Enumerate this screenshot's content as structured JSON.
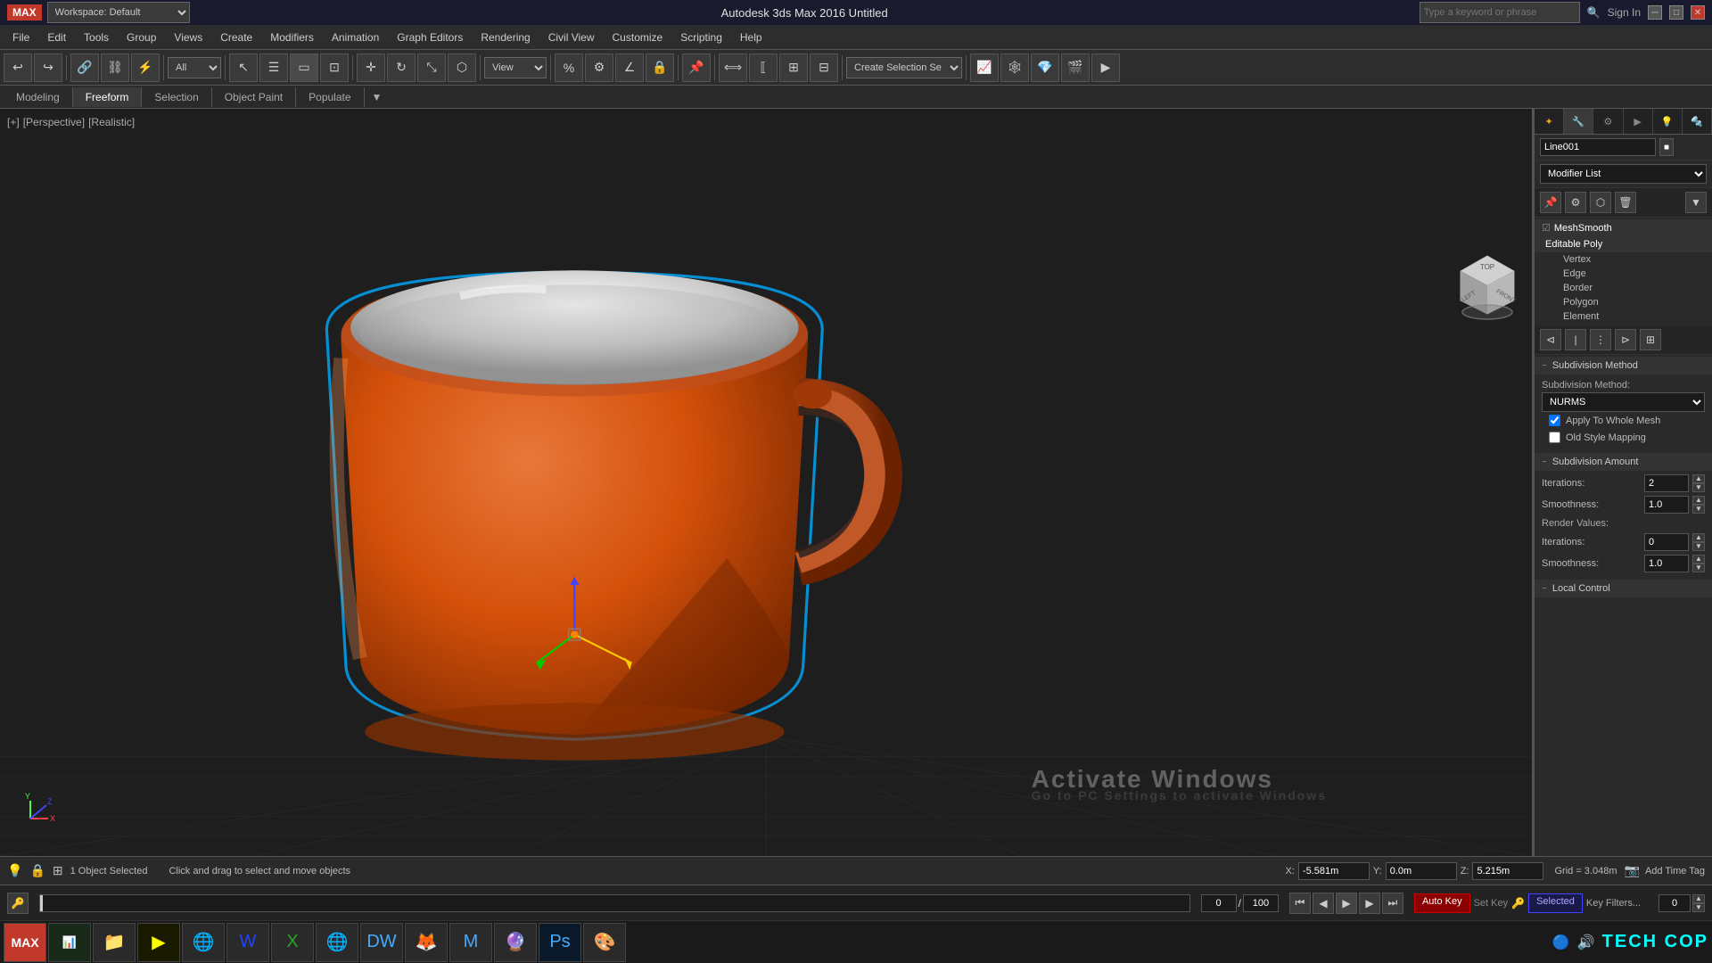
{
  "titlebar": {
    "app_logo": "MAX",
    "workspace": "Workspace: Default",
    "title": "Autodesk 3ds Max 2016   Untitled",
    "search_placeholder": "Type a keyword or phrase",
    "sign_in": "Sign In",
    "min_label": "─",
    "max_label": "□",
    "close_label": "✕"
  },
  "menubar": {
    "items": [
      "File",
      "Edit",
      "Tools",
      "Group",
      "Views",
      "Create",
      "Modifiers",
      "Animation",
      "Graph Editors",
      "Rendering",
      "Civil View",
      "Customize",
      "Scripting",
      "Help"
    ]
  },
  "toolbar2": {
    "tabs": [
      "Modeling",
      "Freeform",
      "Selection",
      "Object Paint",
      "Populate"
    ]
  },
  "viewport": {
    "labels": [
      "[+]",
      "[Perspective]",
      "[Realistic]"
    ],
    "cursor": "default"
  },
  "right_panel": {
    "object_name": "Line001",
    "modifier_list_label": "Modifier List",
    "stack": {
      "items": [
        {
          "label": "MeshSmooth",
          "type": "modifier",
          "selected": false
        },
        {
          "label": "Editable Poly",
          "type": "root",
          "selected": false
        },
        {
          "label": "Vertex",
          "type": "sub",
          "selected": false
        },
        {
          "label": "Edge",
          "type": "sub",
          "selected": false
        },
        {
          "label": "Border",
          "type": "sub",
          "selected": false
        },
        {
          "label": "Polygon",
          "type": "sub",
          "selected": false
        },
        {
          "label": "Element",
          "type": "sub",
          "selected": false
        }
      ]
    },
    "subdivision_method": {
      "section_label": "Subdivision Method",
      "method_label": "Subdivision Method:",
      "method_value": "NURMS",
      "apply_whole_mesh_label": "Apply To Whole Mesh",
      "apply_whole_mesh_checked": true,
      "old_style_label": "Old Style Mapping",
      "old_style_checked": false
    },
    "subdivision_amount": {
      "section_label": "Subdivision Amount",
      "iterations_label": "Iterations:",
      "iterations_value": "2",
      "smoothness_label": "Smoothness:",
      "smoothness_value": "1.0",
      "render_values_label": "Render Values:",
      "render_iter_label": "Iterations:",
      "render_iter_value": "0",
      "render_smooth_label": "Smoothness:",
      "render_smooth_value": "1.0"
    },
    "local_control": {
      "section_label": "Local Control"
    }
  },
  "statusbar": {
    "object_count": "1 Object Selected",
    "hint": "Click and drag to select and move objects",
    "x_label": "X:",
    "x_value": "-5.581m",
    "y_label": "Y:",
    "y_value": "0.0m",
    "z_label": "Z:",
    "z_value": "5.215m",
    "grid_label": "Grid =",
    "grid_value": "3.048m",
    "add_time_tag": "Add Time Tag"
  },
  "animbar": {
    "frame_label": "0 / 100",
    "auto_key": "Auto Key",
    "set_key": "Set Key",
    "selected_label": "Selected",
    "key_filters": "Key Filters...",
    "frame_value": "0"
  },
  "taskbar": {
    "apps": [
      "🖼",
      "📁",
      "🎬",
      "🌐",
      "📄",
      "📊",
      "🔧",
      "🌿",
      "🔮",
      "🎨",
      "🐾"
    ],
    "techcop": "TECH COP"
  },
  "colors": {
    "cup_orange": "#d4500a",
    "cup_highlight": "#e8784a",
    "cup_shadow": "#8b3000",
    "viewport_bg": "#1e1e1e",
    "grid": "#444",
    "selection_blue": "#00aaff",
    "panel_bg": "#2a2a2a"
  }
}
